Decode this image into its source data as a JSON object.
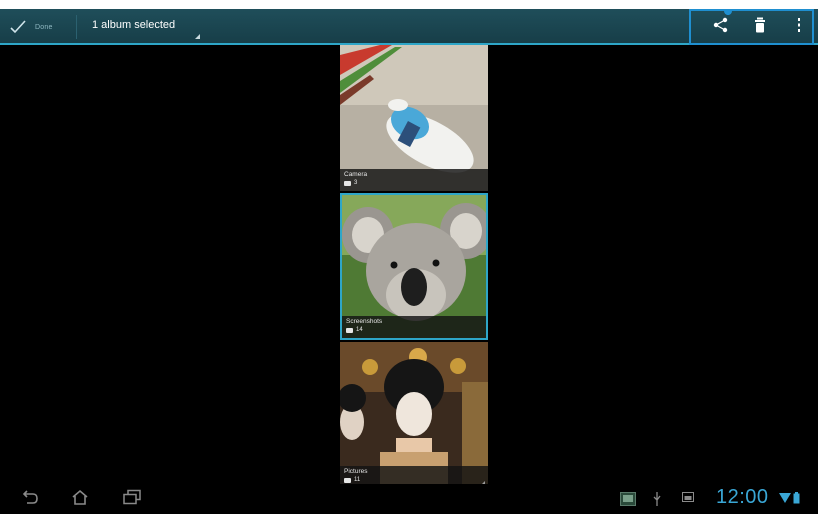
{
  "action_bar": {
    "done_label": "Done",
    "selection_label": "1 album selected",
    "actions": [
      {
        "name": "share",
        "icon": "share-icon"
      },
      {
        "name": "delete",
        "icon": "trash-icon"
      },
      {
        "name": "overflow",
        "icon": "overflow-menu-icon"
      }
    ]
  },
  "albums": [
    {
      "name": "Camera",
      "count": "3",
      "selected": false
    },
    {
      "name": "Screenshots",
      "count": "14",
      "selected": true
    },
    {
      "name": "Pictures",
      "count": "11",
      "selected": false
    }
  ],
  "system_bar": {
    "time": "12:00",
    "nav": [
      "back-icon",
      "home-icon",
      "recent-apps-icon"
    ],
    "status_icons": [
      "gallery-notification-icon",
      "usb-icon",
      "screenshot-icon",
      "wifi-icon",
      "battery-icon"
    ]
  },
  "colors": {
    "accent": "#2ea6c8",
    "action_bar": "#1f4e5a",
    "highlight": "#1f8fd0",
    "clock": "#3aa7d6"
  }
}
